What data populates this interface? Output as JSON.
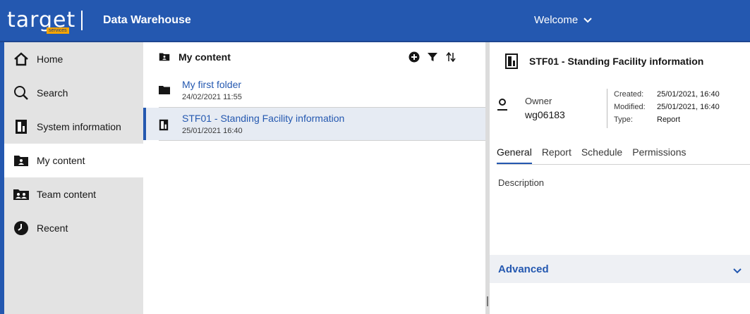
{
  "header": {
    "logo_text": "target",
    "logo_sub": "services",
    "app_title": "Data Warehouse",
    "welcome_label": "Welcome"
  },
  "nav": {
    "items": [
      {
        "label": "Home",
        "icon": "home-icon"
      },
      {
        "label": "Search",
        "icon": "search-icon"
      },
      {
        "label": "System information",
        "icon": "report-icon"
      },
      {
        "label": "My content",
        "icon": "my-folder-icon",
        "active": true
      },
      {
        "label": "Team content",
        "icon": "team-folder-icon"
      },
      {
        "label": "Recent",
        "icon": "recent-icon"
      }
    ]
  },
  "content": {
    "title": "My content",
    "items": [
      {
        "title": "My first folder",
        "date": "24/02/2021 11:55",
        "icon": "folder-icon"
      },
      {
        "title": "STF01 - Standing Facility information",
        "date": "25/01/2021 16:40",
        "icon": "report-icon",
        "selected": true
      }
    ]
  },
  "details": {
    "title": "STF01 - Standing Facility information",
    "owner_label": "Owner",
    "owner_value": "wg06183",
    "created_label": "Created:",
    "created_value": "25/01/2021, 16:40",
    "modified_label": "Modified:",
    "modified_value": "25/01/2021, 16:40",
    "type_label": "Type:",
    "type_value": "Report",
    "tabs": [
      "General",
      "Report",
      "Schedule",
      "Permissions"
    ],
    "description_label": "Description",
    "advanced_label": "Advanced"
  },
  "colors": {
    "brand": "#2458b0",
    "nav_bg": "#e3e3e3",
    "selection": "#e6ebf3"
  }
}
